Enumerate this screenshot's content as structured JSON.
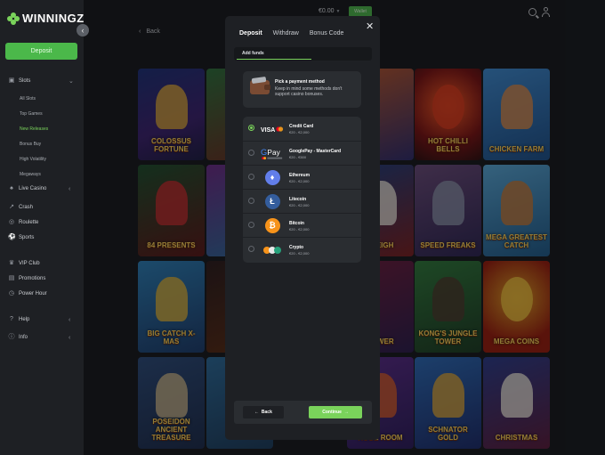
{
  "brand": {
    "name": "WINNINGZ"
  },
  "sidebar": {
    "collapse_icon": "chevron-left-icon",
    "deposit_label": "Deposit",
    "sections": [
      {
        "label": "Slots",
        "icon": "slots-icon",
        "expanded": true
      },
      {
        "label": "Live Casino",
        "icon": "live-casino-icon"
      },
      {
        "label": "Crash",
        "icon": "crash-icon"
      },
      {
        "label": "Roulette",
        "icon": "roulette-icon"
      },
      {
        "label": "Sports",
        "icon": "sports-icon"
      },
      {
        "label": "VIP Club",
        "icon": "vip-icon"
      },
      {
        "label": "Promotions",
        "icon": "promotions-icon"
      },
      {
        "label": "Power Hour",
        "icon": "power-hour-icon"
      },
      {
        "label": "Help",
        "icon": "help-icon"
      },
      {
        "label": "Info",
        "icon": "info-icon"
      }
    ],
    "slot_subitems": [
      "All Slots",
      "Top Games",
      "New Releases",
      "Bonus Buy",
      "High Volatility",
      "Megaways"
    ],
    "active_subitem": "New Releases"
  },
  "topbar": {
    "balance": "€0.00",
    "button_label": "Wallet",
    "back_label": "Back"
  },
  "games": [
    "COLOSSUS FORTUNE",
    "",
    "",
    "HOT CHILLI BELLS",
    "CHICKEN FARM",
    "84 PRESENTS",
    "",
    "SLEIGH",
    "SPEED FREAKS",
    "MEGA GREATEST CATCH",
    "BIG CATCH X-MAS",
    "",
    "POWER",
    "KONG'S JUNGLE TOWER",
    "MEGA COINS",
    "POSEIDON ANCIENT TREASURE",
    "",
    "HUGE ROOM",
    "SCHNATOR GOLD",
    "CHRISTMAS"
  ],
  "modal": {
    "tabs": [
      "Deposit",
      "Withdraw",
      "Bonus Code"
    ],
    "active_tab": "Deposit",
    "close_icon": "close-icon",
    "subtab": "Add funds",
    "info_title": "Pick a payment method",
    "info_text": "Keep in mind some methods don't support casino bonuses.",
    "methods": [
      {
        "name": "Credit Card",
        "range": "€20 - €2,000",
        "logo": "visa-mastercard-icon",
        "selected": true
      },
      {
        "name": "GooglePay - MasterCard",
        "range": "€20 - €500",
        "logo": "google-pay-icon",
        "selected": false
      },
      {
        "name": "Ethereum",
        "range": "€20 - €2,000",
        "logo": "ethereum-icon",
        "selected": false
      },
      {
        "name": "Litecoin",
        "range": "€20 - €2,000",
        "logo": "litecoin-icon",
        "selected": false
      },
      {
        "name": "Bitcoin",
        "range": "€20 - €2,000",
        "logo": "bitcoin-icon",
        "selected": false
      },
      {
        "name": "Crypto",
        "range": "€20 - €2,000",
        "logo": "crypto-coins-icon",
        "selected": false
      }
    ],
    "back_label": "Back",
    "continue_label": "Continue"
  },
  "colors": {
    "accent": "#7ad35b",
    "panel": "#1e2024",
    "card": "#2a2d31"
  }
}
